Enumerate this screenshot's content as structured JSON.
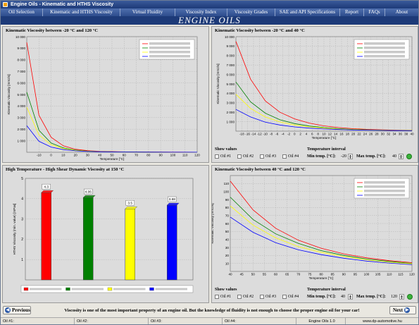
{
  "window": {
    "title": "Engine Oils - Kinematic and HTHS Viscosity"
  },
  "menu": [
    "Oil Selection",
    "Kinematic and HTHS Viscosity",
    "Virtual Fluidity",
    "Viscosity Index",
    "Viscosity Grades",
    "SAE and API Specifications",
    "Report",
    "FAQs",
    "About"
  ],
  "banner": "ENGINE OILS",
  "panels": {
    "kv_wide": {
      "title": "Kinematic Viscosity between -20 °C and 120 °C"
    },
    "kv_cold": {
      "title": "Kinematic Viscosity between -20 °C and 40 °C"
    },
    "hths": {
      "title": "High Temperature - High Shear Dynamic Viscosity at 150 °C"
    },
    "kv_hot": {
      "title": "Kinematic Viscosity between 40 °C and 120 °C"
    }
  },
  "controls_cold": {
    "show_values": "Show values",
    "oils": [
      "Oil #1",
      "Oil #2",
      "Oil #3",
      "Oil #4"
    ],
    "interval_label": "Temperature interval",
    "min_label": "Min temp. [°C]:",
    "min_value": "-20",
    "max_label": "Max temp. [°C]:",
    "max_value": "40"
  },
  "controls_hot": {
    "show_values": "Show values",
    "oils": [
      "Oil #1",
      "Oil #2",
      "Oil #3",
      "Oil #4"
    ],
    "interval_label": "Temperature interval",
    "min_label": "Min temp. [°C]:",
    "min_value": "40",
    "max_label": "Max temp. [°C]:",
    "max_value": "120"
  },
  "nav": {
    "previous": "Previous",
    "next": "Next"
  },
  "bottom_text": "Viscosity is one of the most important property of an engine oil. But the knowledge of fluidity is not enough to choose the proper engine oil for your car!",
  "status": {
    "oil1": "Oil #1:",
    "oil2": "Oil #2:",
    "oil3": "Oil #3:",
    "oil4": "Oil #4:",
    "version": "Engine Oils 1.0",
    "site": "www.dp-automotive.hu"
  },
  "colors": {
    "oil1": "#ff0000",
    "oil2": "#008000",
    "oil3": "#ffff00",
    "oil4": "#0000ff"
  },
  "chart_data": [
    {
      "type": "line",
      "title": "Kinematic Viscosity between -20 °C and 120 °C",
      "xlabel": "Temperature [°C]",
      "ylabel": "Kinematic Viscosity [mm2/s]",
      "xlim": [
        -20,
        120
      ],
      "ylim": [
        0,
        10000
      ],
      "xticks": [
        -10,
        0,
        10,
        20,
        30,
        40,
        50,
        60,
        70,
        80,
        90,
        100,
        110,
        120
      ],
      "yticks": [
        1000,
        2000,
        3000,
        4000,
        5000,
        6000,
        7000,
        8000,
        9000,
        10000
      ],
      "grid": true,
      "legend": "top-right",
      "series": [
        {
          "x": [
            -20,
            -10,
            0,
            10,
            20,
            30,
            40,
            60,
            80,
            100,
            120
          ],
          "values": [
            9500,
            3200,
            1300,
            560,
            260,
            140,
            80,
            35,
            18,
            11,
            7
          ]
        },
        {
          "x": [
            -20,
            -10,
            0,
            10,
            20,
            30,
            40,
            60,
            80,
            100,
            120
          ],
          "values": [
            5200,
            1900,
            800,
            380,
            190,
            105,
            62,
            28,
            15,
            9,
            6
          ]
        },
        {
          "x": [
            -20,
            -10,
            0,
            10,
            20,
            30,
            40,
            60,
            80,
            100,
            120
          ],
          "values": [
            3900,
            1500,
            650,
            320,
            160,
            90,
            55,
            25,
            14,
            8,
            5
          ]
        },
        {
          "x": [
            -20,
            -10,
            0,
            10,
            20,
            30,
            40,
            60,
            80,
            100,
            120
          ],
          "values": [
            2300,
            950,
            450,
            230,
            125,
            75,
            46,
            22,
            12,
            7,
            5
          ]
        }
      ]
    },
    {
      "type": "line",
      "title": "Kinematic Viscosity between -20 °C and 40 °C",
      "xlabel": "Temperature [°C]",
      "ylabel": "Kinematic Viscosity [mm2/s]",
      "xlim": [
        -20,
        40
      ],
      "ylim": [
        0,
        10000
      ],
      "xticks": [
        -18,
        -16,
        -14,
        -12,
        -10,
        -8,
        -6,
        -4,
        -2,
        0,
        2,
        4,
        6,
        8,
        10,
        12,
        14,
        16,
        18,
        20,
        22,
        24,
        26,
        28,
        30,
        32,
        34,
        36,
        38,
        40
      ],
      "yticks": [
        1000,
        2000,
        3000,
        4000,
        5000,
        6000,
        7000,
        8000,
        9000,
        10000
      ],
      "grid": true,
      "legend": "top-right",
      "series": [
        {
          "x": [
            -20,
            -15,
            -10,
            -5,
            0,
            5,
            10,
            15,
            20,
            25,
            30,
            35,
            40
          ],
          "values": [
            9500,
            5500,
            3200,
            2000,
            1300,
            850,
            560,
            380,
            260,
            190,
            140,
            105,
            80
          ]
        },
        {
          "x": [
            -20,
            -15,
            -10,
            -5,
            0,
            5,
            10,
            15,
            20,
            25,
            30,
            35,
            40
          ],
          "values": [
            5200,
            3100,
            1900,
            1200,
            800,
            540,
            380,
            260,
            190,
            140,
            105,
            80,
            62
          ]
        },
        {
          "x": [
            -20,
            -15,
            -10,
            -5,
            0,
            5,
            10,
            15,
            20,
            25,
            30,
            35,
            40
          ],
          "values": [
            3900,
            2400,
            1500,
            980,
            650,
            450,
            320,
            220,
            160,
            120,
            90,
            70,
            55
          ]
        },
        {
          "x": [
            -20,
            -15,
            -10,
            -5,
            0,
            5,
            10,
            15,
            20,
            25,
            30,
            35,
            40
          ],
          "values": [
            2300,
            1500,
            950,
            650,
            450,
            320,
            230,
            170,
            125,
            95,
            75,
            58,
            46
          ]
        }
      ]
    },
    {
      "type": "bar",
      "title": "High Temperature - High Shear Dynamic Viscosity at 150 °C",
      "ylabel": "HTHS Viscosity (min. value) [mPas]",
      "categories": [
        "Oil #1",
        "Oil #2",
        "Oil #3",
        "Oil #4"
      ],
      "values": [
        4.3,
        4.06,
        3.5,
        3.68
      ],
      "data_labels": [
        "4.3",
        "4.06",
        "3.5",
        "3.68"
      ],
      "ylim": [
        0,
        5
      ],
      "yticks": [
        1,
        2,
        3,
        4,
        5
      ],
      "grid": true,
      "legend": "bottom"
    },
    {
      "type": "line",
      "title": "Kinematic Viscosity between 40 °C and 120 °C",
      "xlabel": "Temperature [°C]",
      "ylabel": "Kinematic Viscosity [mm2/s]",
      "xlim": [
        40,
        120
      ],
      "ylim": [
        0,
        120
      ],
      "xticks": [
        40,
        45,
        50,
        55,
        60,
        65,
        70,
        75,
        80,
        85,
        90,
        95,
        100,
        105,
        110,
        115,
        120
      ],
      "yticks": [
        10,
        20,
        30,
        40,
        50,
        60,
        70,
        80,
        90,
        100,
        110
      ],
      "grid": true,
      "legend": "top-right",
      "series": [
        {
          "x": [
            40,
            50,
            60,
            70,
            80,
            90,
            100,
            110,
            120
          ],
          "values": [
            113,
            77,
            54,
            39,
            29,
            22,
            17,
            13.5,
            11
          ]
        },
        {
          "x": [
            40,
            50,
            60,
            70,
            80,
            90,
            100,
            110,
            120
          ],
          "values": [
            93,
            65,
            47,
            35,
            26,
            20,
            15.5,
            12.5,
            10
          ]
        },
        {
          "x": [
            40,
            50,
            60,
            70,
            80,
            90,
            100,
            110,
            120
          ],
          "values": [
            82,
            58,
            42,
            31,
            24,
            18.5,
            14.5,
            11.5,
            9.5
          ]
        },
        {
          "x": [
            40,
            50,
            60,
            70,
            80,
            90,
            100,
            110,
            120
          ],
          "values": [
            68,
            49,
            36,
            27,
            21,
            16.5,
            13,
            10.5,
            8.5
          ]
        }
      ]
    }
  ]
}
